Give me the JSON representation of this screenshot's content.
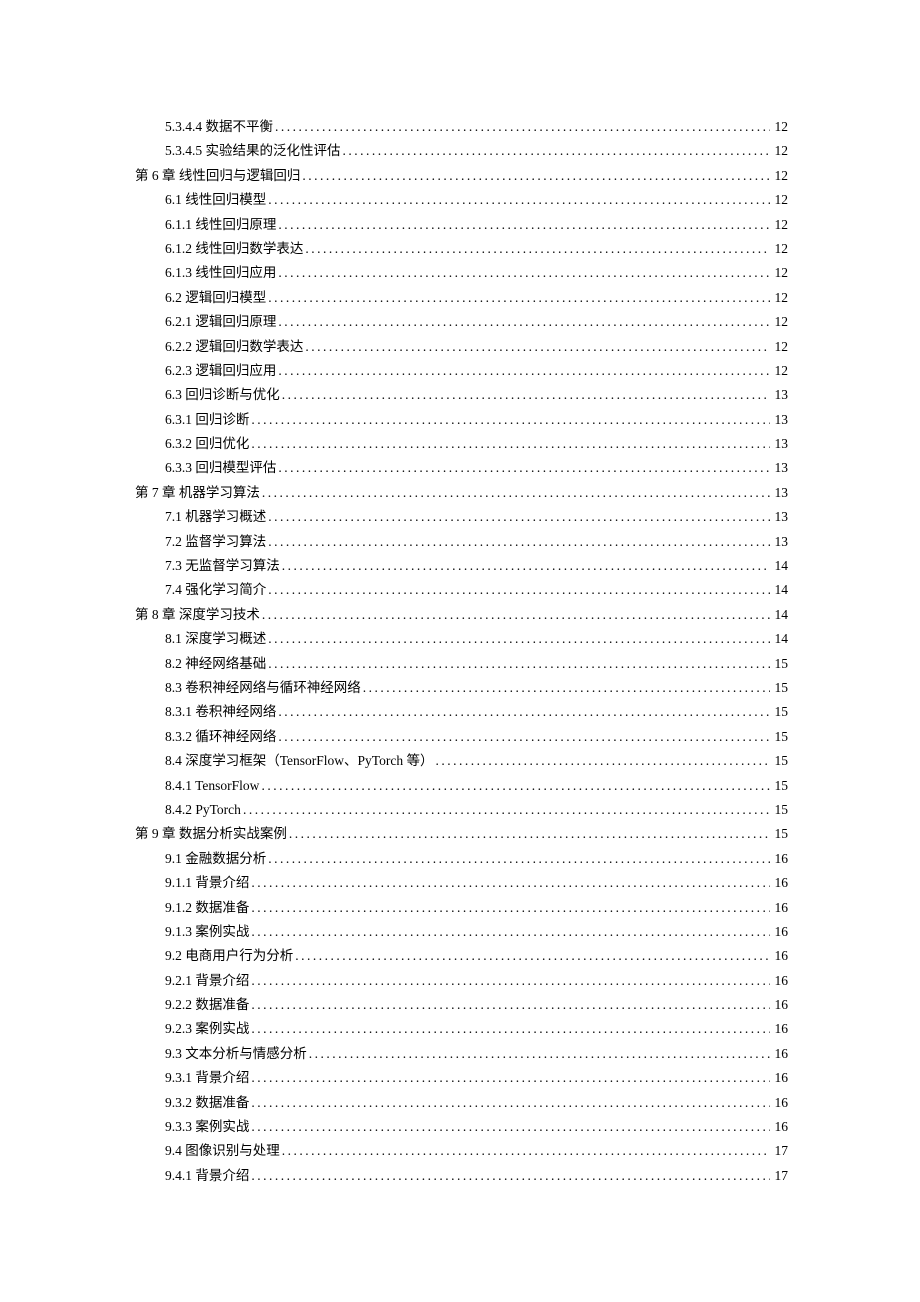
{
  "toc": [
    {
      "level": 1,
      "label": "5.3.4.4 数据不平衡",
      "page": "12"
    },
    {
      "level": 1,
      "label": "5.3.4.5 实验结果的泛化性评估",
      "page": "12"
    },
    {
      "level": 0,
      "label": "第 6 章 线性回归与逻辑回归",
      "page": "12"
    },
    {
      "level": 1,
      "label": "6.1 线性回归模型",
      "page": "12"
    },
    {
      "level": 1,
      "label": "6.1.1 线性回归原理",
      "page": "12"
    },
    {
      "level": 1,
      "label": "6.1.2 线性回归数学表达",
      "page": "12"
    },
    {
      "level": 1,
      "label": "6.1.3 线性回归应用",
      "page": "12"
    },
    {
      "level": 1,
      "label": "6.2 逻辑回归模型",
      "page": "12"
    },
    {
      "level": 1,
      "label": "6.2.1 逻辑回归原理",
      "page": "12"
    },
    {
      "level": 1,
      "label": "6.2.2 逻辑回归数学表达",
      "page": "12"
    },
    {
      "level": 1,
      "label": "6.2.3 逻辑回归应用",
      "page": "12"
    },
    {
      "level": 1,
      "label": "6.3 回归诊断与优化",
      "page": "13"
    },
    {
      "level": 1,
      "label": "6.3.1 回归诊断",
      "page": "13"
    },
    {
      "level": 1,
      "label": "6.3.2 回归优化",
      "page": "13"
    },
    {
      "level": 1,
      "label": "6.3.3 回归模型评估",
      "page": "13"
    },
    {
      "level": 0,
      "label": "第 7 章 机器学习算法",
      "page": "13"
    },
    {
      "level": 1,
      "label": "7.1 机器学习概述",
      "page": "13"
    },
    {
      "level": 1,
      "label": "7.2 监督学习算法",
      "page": "13"
    },
    {
      "level": 1,
      "label": "7.3 无监督学习算法",
      "page": "14"
    },
    {
      "level": 1,
      "label": "7.4 强化学习简介",
      "page": "14"
    },
    {
      "level": 0,
      "label": "第 8 章 深度学习技术",
      "page": "14"
    },
    {
      "level": 1,
      "label": "8.1 深度学习概述",
      "page": "14"
    },
    {
      "level": 1,
      "label": "8.2 神经网络基础",
      "page": "15"
    },
    {
      "level": 1,
      "label": "8.3 卷积神经网络与循环神经网络",
      "page": "15"
    },
    {
      "level": 1,
      "label": "8.3.1 卷积神经网络",
      "page": "15"
    },
    {
      "level": 1,
      "label": "8.3.2 循环神经网络",
      "page": "15"
    },
    {
      "level": 1,
      "label": "8.4 深度学习框架（TensorFlow、PyTorch 等）",
      "page": "15"
    },
    {
      "level": 1,
      "label": "8.4.1 TensorFlow",
      "page": "15"
    },
    {
      "level": 1,
      "label": "8.4.2 PyTorch",
      "page": "15"
    },
    {
      "level": 0,
      "label": "第 9 章 数据分析实战案例",
      "page": "15"
    },
    {
      "level": 1,
      "label": "9.1 金融数据分析",
      "page": "16"
    },
    {
      "level": 1,
      "label": "9.1.1 背景介绍",
      "page": "16"
    },
    {
      "level": 1,
      "label": "9.1.2 数据准备",
      "page": "16"
    },
    {
      "level": 1,
      "label": "9.1.3 案例实战",
      "page": "16"
    },
    {
      "level": 1,
      "label": "9.2 电商用户行为分析",
      "page": "16"
    },
    {
      "level": 1,
      "label": "9.2.1 背景介绍",
      "page": "16"
    },
    {
      "level": 1,
      "label": "9.2.2 数据准备",
      "page": "16"
    },
    {
      "level": 1,
      "label": "9.2.3 案例实战",
      "page": "16"
    },
    {
      "level": 1,
      "label": "9.3 文本分析与情感分析",
      "page": "16"
    },
    {
      "level": 1,
      "label": "9.3.1 背景介绍",
      "page": "16"
    },
    {
      "level": 1,
      "label": "9.3.2 数据准备",
      "page": "16"
    },
    {
      "level": 1,
      "label": "9.3.3 案例实战",
      "page": "16"
    },
    {
      "level": 1,
      "label": "9.4 图像识别与处理",
      "page": "17"
    },
    {
      "level": 1,
      "label": "9.4.1 背景介绍",
      "page": "17"
    }
  ]
}
